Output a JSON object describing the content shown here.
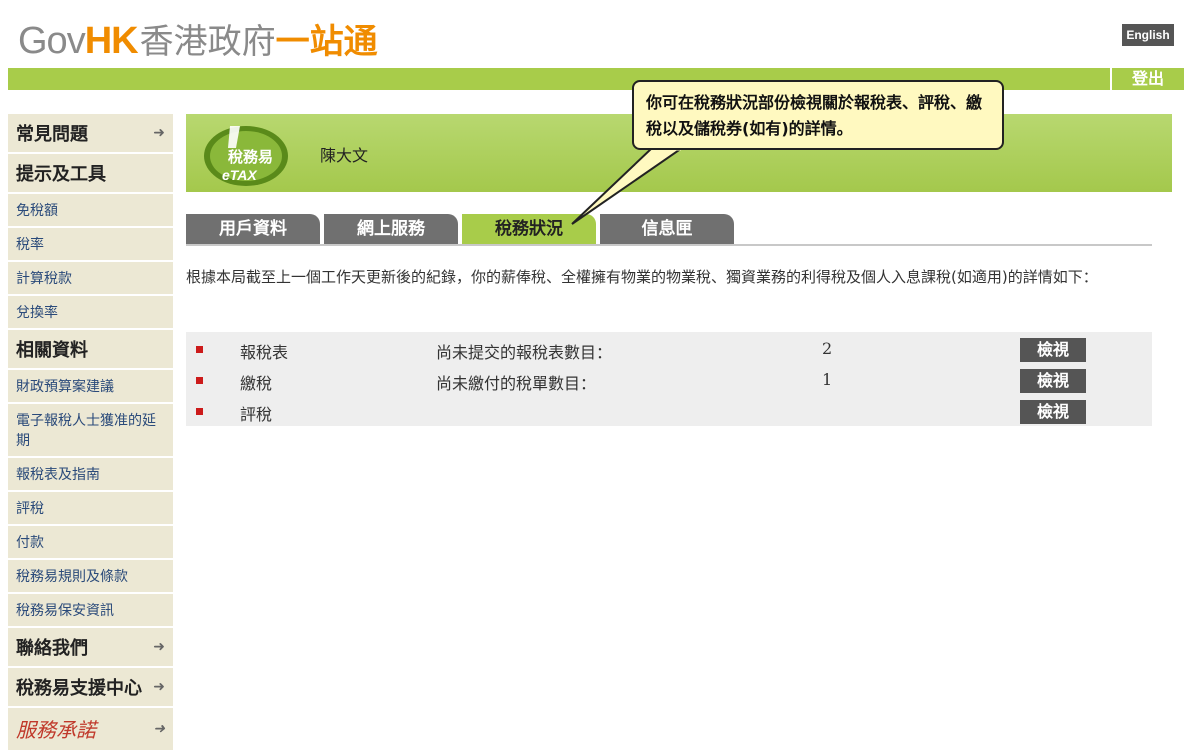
{
  "header": {
    "logo_gov": "Gov",
    "logo_hk": "HK",
    "logo_zh_a": "香港政府",
    "logo_zh_b": "一站通",
    "language_label": "English",
    "logout_label": "登出"
  },
  "sidebar": {
    "items": [
      {
        "label": "常見問題",
        "type": "head",
        "arrow": true
      },
      {
        "label": "提示及工具",
        "type": "head",
        "arrow": false
      },
      {
        "label": "免稅額",
        "type": "link"
      },
      {
        "label": "稅率",
        "type": "link"
      },
      {
        "label": "計算稅款",
        "type": "link"
      },
      {
        "label": "兌換率",
        "type": "link"
      },
      {
        "label": "相關資料",
        "type": "head",
        "arrow": false
      },
      {
        "label": "財政預算案建議",
        "type": "link"
      },
      {
        "label": "電子報稅人士獲准的延期",
        "type": "link"
      },
      {
        "label": "報稅表及指南",
        "type": "link"
      },
      {
        "label": "評稅",
        "type": "link"
      },
      {
        "label": "付款",
        "type": "link"
      },
      {
        "label": "稅務易規則及條款",
        "type": "link"
      },
      {
        "label": "稅務易保安資訊",
        "type": "link"
      },
      {
        "label": "聯絡我們",
        "type": "head",
        "arrow": true
      },
      {
        "label": "稅務易支援中心",
        "type": "head",
        "arrow": true
      },
      {
        "label": "服務承諾",
        "type": "promise",
        "arrow": true
      }
    ],
    "arrow_glyph": "➜"
  },
  "account": {
    "etax_logo_zh": "稅務易",
    "etax_logo_en": "eTAX",
    "user_name": "陳大文"
  },
  "callout": {
    "text": "你可在稅務狀況部份檢視關於報稅表、評稅、繳稅以及儲稅券(如有)的詳情。"
  },
  "tabs": [
    {
      "label": "用戶資料",
      "active": false
    },
    {
      "label": "網上服務",
      "active": false
    },
    {
      "label": "稅務狀況",
      "active": true
    },
    {
      "label": "信息匣",
      "active": false
    }
  ],
  "intro_text": "根據本局截至上一個工作天更新後的紀錄，你的薪俸稅、全權擁有物業的物業稅、獨資業務的利得稅及個人入息課稅(如適用)的詳情如下：",
  "summary_rows": [
    {
      "label": "報稅表",
      "desc": "尚未提交的報稅表數目：",
      "count": "2",
      "button": "檢視"
    },
    {
      "label": "繳稅",
      "desc": "尚未繳付的稅單數目：",
      "count": "1",
      "button": "檢視"
    },
    {
      "label": "評稅",
      "desc": "",
      "count": "",
      "button": "檢視"
    }
  ],
  "colors": {
    "brand_green": "#a8cc4a",
    "brand_orange": "#f08c00",
    "button_gray": "#555555",
    "bullet_red": "#cc1a1a"
  }
}
